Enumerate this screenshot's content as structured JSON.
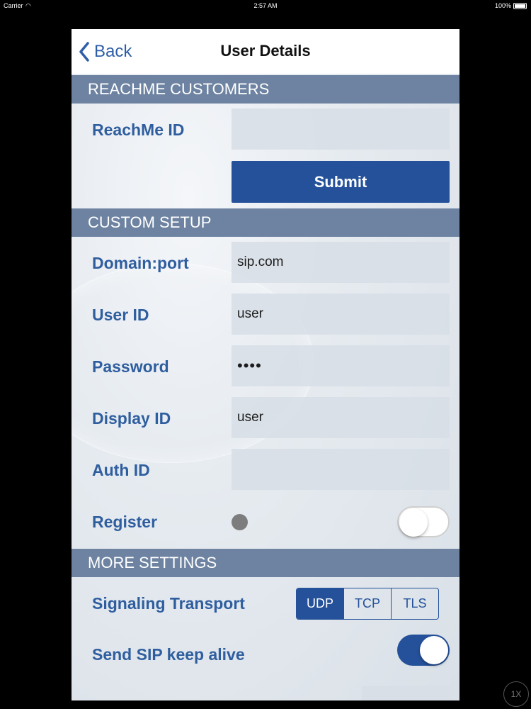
{
  "status_bar": {
    "carrier": "Carrier",
    "time": "2:57 AM",
    "battery": "100%"
  },
  "nav": {
    "back_label": "Back",
    "title": "User Details"
  },
  "sections": {
    "reachme": {
      "header": "REACHME CUSTOMERS",
      "reachme_id_label": "ReachMe ID",
      "reachme_id_value": "",
      "submit_label": "Submit"
    },
    "custom": {
      "header": "CUSTOM SETUP",
      "fields": [
        {
          "label": "Domain:port",
          "value": "sip.com"
        },
        {
          "label": "User ID",
          "value": "user"
        },
        {
          "label": "Password",
          "value": "••••"
        },
        {
          "label": "Display ID",
          "value": "user"
        },
        {
          "label": "Auth ID",
          "value": ""
        }
      ],
      "register_label": "Register",
      "register_on": false
    },
    "more": {
      "header": "MORE SETTINGS",
      "transport_label": "Signaling Transport",
      "transport_options": [
        "UDP",
        "TCP",
        "TLS"
      ],
      "transport_selected": "UDP",
      "keepalive_label": "Send SIP keep alive",
      "keepalive_on": true
    }
  },
  "zoom_badge": "1X",
  "colors": {
    "accent": "#24519a",
    "section_header": "#6d83a1",
    "label": "#2f5e9f"
  }
}
